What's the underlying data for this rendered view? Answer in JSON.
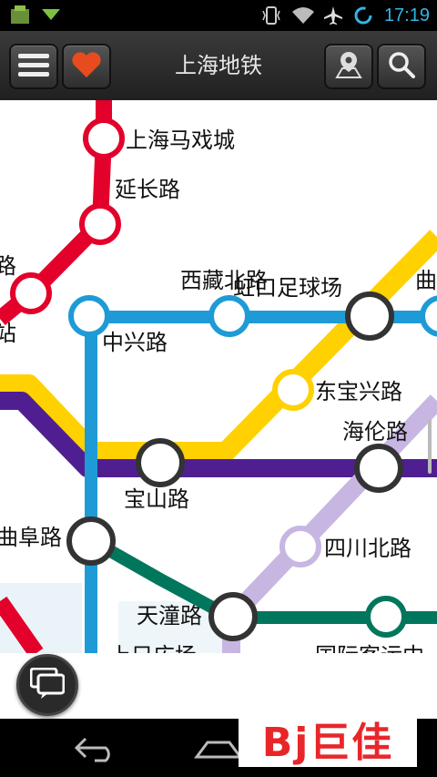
{
  "status_bar": {
    "time": "17:19",
    "icons": [
      "app-icon",
      "download-icon",
      "vibrate-icon",
      "wifi-icon",
      "airplane-icon",
      "sync-icon"
    ]
  },
  "app_bar": {
    "title": "上海地铁",
    "menu_icon": "menu-icon",
    "favorite_icon": "heart-icon",
    "location_icon": "location-pin-icon",
    "search_icon": "search-icon"
  },
  "map": {
    "line_colors": {
      "red": "#e3002b",
      "blue": "#1e9bd7",
      "yellow": "#ffd100",
      "purple": "#4f1f91",
      "green": "#00775c",
      "lilac": "#c8b6e2"
    },
    "stations": [
      {
        "id": "s1",
        "label": "上海马戏城"
      },
      {
        "id": "s2",
        "label": "延长路"
      },
      {
        "id": "s3",
        "label": "路"
      },
      {
        "id": "s4",
        "label": "站"
      },
      {
        "id": "s5",
        "label": "中兴路"
      },
      {
        "id": "s6",
        "label": "西藏北路"
      },
      {
        "id": "s7",
        "label": "虹口足球场"
      },
      {
        "id": "s8",
        "label": "曲"
      },
      {
        "id": "s9",
        "label": "东宝兴路"
      },
      {
        "id": "s10",
        "label": "海伦路"
      },
      {
        "id": "s11",
        "label": "宝山路"
      },
      {
        "id": "s12",
        "label": "曲阜路"
      },
      {
        "id": "s13",
        "label": "四川北路"
      },
      {
        "id": "s14",
        "label": "天潼路"
      },
      {
        "id": "s15",
        "label": "上只広场"
      },
      {
        "id": "s16",
        "label": "国际客运中"
      }
    ]
  },
  "overlay": {
    "chat_icon": "chat-bubbles-icon",
    "watermark": "Bj巨佳"
  },
  "nav_bar": {
    "back_icon": "back-icon",
    "home_icon": "home-icon"
  }
}
